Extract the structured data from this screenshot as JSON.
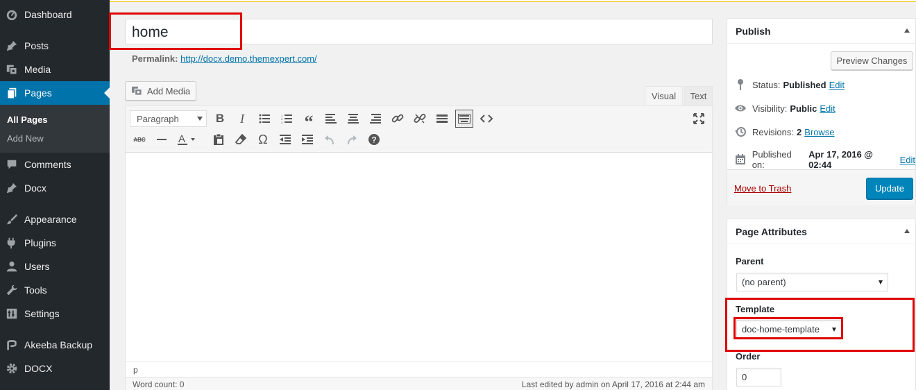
{
  "sidebar": {
    "items": [
      {
        "label": "Dashboard",
        "icon": "dashboard-icon"
      },
      {
        "label": "Posts",
        "icon": "pin-icon"
      },
      {
        "label": "Media",
        "icon": "media-icon"
      },
      {
        "label": "Pages",
        "icon": "pages-icon"
      },
      {
        "label": "Comments",
        "icon": "comment-icon"
      },
      {
        "label": "Docx",
        "icon": "pin-icon"
      },
      {
        "label": "Appearance",
        "icon": "brush-icon"
      },
      {
        "label": "Plugins",
        "icon": "plugin-icon"
      },
      {
        "label": "Users",
        "icon": "user-icon"
      },
      {
        "label": "Tools",
        "icon": "wrench-icon"
      },
      {
        "label": "Settings",
        "icon": "settings-icon"
      },
      {
        "label": "Akeeba Backup",
        "icon": "akeeba-icon"
      },
      {
        "label": "DOCX",
        "icon": "gear-icon"
      }
    ],
    "submenu": {
      "all_pages": "All Pages",
      "add_new": "Add New"
    }
  },
  "editor": {
    "title": "home",
    "permalink_label": "Permalink:",
    "permalink_url": "http://docx.demo.themexpert.com/",
    "add_media": "Add Media",
    "tab_visual": "Visual",
    "tab_text": "Text",
    "format": "Paragraph",
    "path": "p",
    "word_count": "Word count: 0",
    "last_edited": "Last edited by admin on April 17, 2016 at 2:44 am"
  },
  "publish": {
    "title": "Publish",
    "preview": "Preview Changes",
    "status_label": "Status:",
    "status_value": "Published",
    "visibility_label": "Visibility:",
    "visibility_value": "Public",
    "revisions_label": "Revisions:",
    "revisions_value": "2",
    "published_label": "Published on:",
    "published_value": "Apr 17, 2016 @ 02:44",
    "edit": "Edit",
    "browse": "Browse",
    "trash": "Move to Trash",
    "update": "Update"
  },
  "attributes": {
    "title": "Page Attributes",
    "parent_label": "Parent",
    "parent_value": "(no parent)",
    "template_label": "Template",
    "template_value": "doc-home-template",
    "order_label": "Order",
    "order_value": "0"
  },
  "colors": {
    "sidebar_bg": "#23282d",
    "accent": "#0073aa",
    "primary_button": "#0085ba",
    "highlight": "#e00000"
  }
}
